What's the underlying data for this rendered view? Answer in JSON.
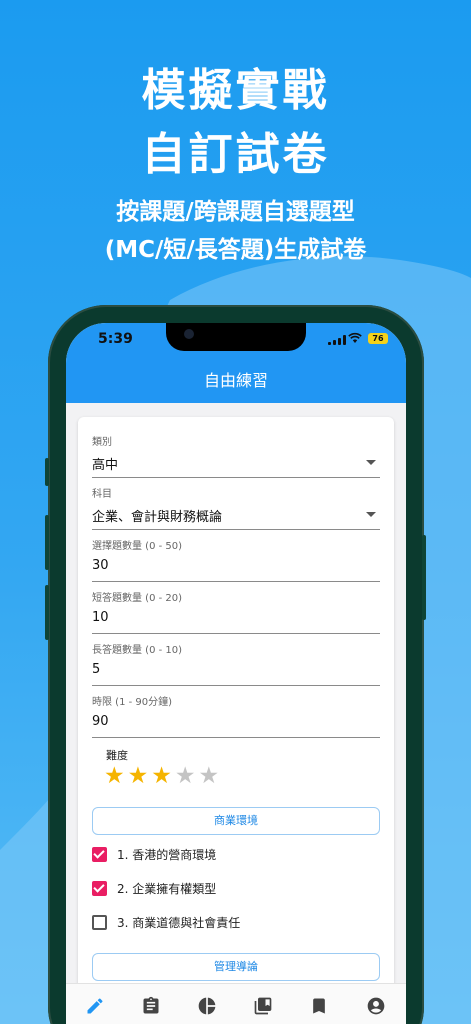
{
  "promo": {
    "headline_line1": "模擬實戰",
    "headline_line2": "自訂試卷",
    "sub_line1": "按課題/跨課題自選題型",
    "sub_line2": "(MC/短/長答題)生成試卷"
  },
  "status_bar": {
    "time": "5:39",
    "battery": "76"
  },
  "app_bar": {
    "title": "自由練習"
  },
  "form": {
    "category": {
      "label": "類別",
      "value": "高中"
    },
    "subject": {
      "label": "科目",
      "value": "企業、會計與財務概論"
    },
    "mc_count": {
      "label": "選擇題數量 (0 - 50)",
      "value": "30"
    },
    "short_count": {
      "label": "短答題數量 (0 - 20)",
      "value": "10"
    },
    "long_count": {
      "label": "長答題數量 (0 - 10)",
      "value": "5"
    },
    "time_limit": {
      "label": "時限 (1 - 90分鐘)",
      "value": "90"
    },
    "difficulty": {
      "label": "難度",
      "rating": 3,
      "max": 5
    }
  },
  "topic_groups": [
    {
      "button": "商業環境",
      "items": [
        {
          "label": "1. 香港的營商環境",
          "checked": true
        },
        {
          "label": "2. 企業擁有權類型",
          "checked": true
        },
        {
          "label": "3. 商業道德與社會責任",
          "checked": false
        }
      ]
    },
    {
      "button": "管理導論"
    }
  ],
  "bottom_nav": [
    {
      "icon": "pencil-icon",
      "active": true
    },
    {
      "icon": "clipboard-icon",
      "active": false
    },
    {
      "icon": "pie-chart-icon",
      "active": false
    },
    {
      "icon": "library-icon",
      "active": false
    },
    {
      "icon": "bookmark-icon",
      "active": false
    },
    {
      "icon": "account-icon",
      "active": false
    }
  ],
  "colors": {
    "primary": "#2196f3",
    "checkbox": "#e91e63",
    "star": "#f5b400",
    "background": "#1b9bf0"
  }
}
